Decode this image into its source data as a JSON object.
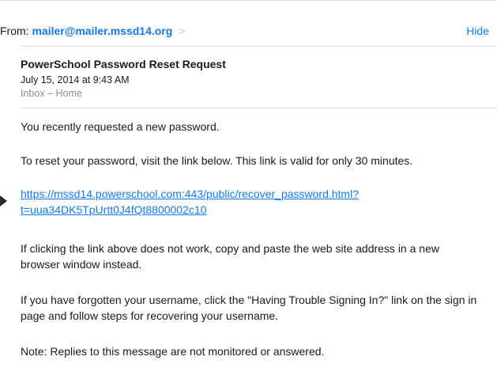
{
  "header": {
    "from_label": "From:",
    "from_address": "mailer@mailer.mssd14.org",
    "chevron": ">",
    "hide_label": "Hide"
  },
  "message": {
    "subject": "PowerSchool Password Reset Request",
    "date": "July 15, 2014 at 9:43 AM",
    "mailbox": "Inbox – Home"
  },
  "body": {
    "p1": "You recently requested a new password.",
    "p2": "To reset your password, visit the link below. This link is valid for only 30 minutes.",
    "link_line1": "https://mssd14.powerschool.com:443/public/recover_password.html?",
    "link_line2": "t=uua34DK5TpUrtt0J4fQt8800002c10",
    "p4": "If clicking the link above does not work, copy and paste the web site address in a new browser window instead.",
    "p5": "If you have forgotten your username, click the \"Having Trouble Signing In?\" link on the sign in page and follow steps for recovering your username.",
    "p6": "Note:  Replies to this message are not monitored or answered."
  },
  "colors": {
    "accent": "#1479ee",
    "secondary_text": "#8e8e93"
  }
}
